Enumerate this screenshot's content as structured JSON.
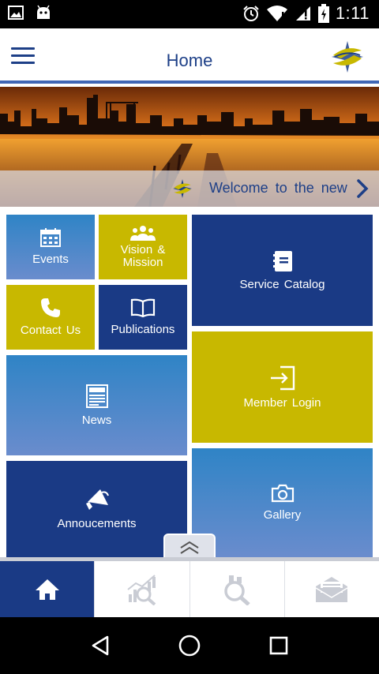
{
  "status_bar": {
    "time": "1:11",
    "left_icons": [
      "image-icon",
      "android-icon"
    ],
    "right_icons": [
      "alarm-icon",
      "wifi-icon",
      "signal-icon",
      "battery-icon"
    ]
  },
  "header": {
    "title": "Home",
    "menu_icon": "hamburger-menu-icon",
    "logo_icon": "star-logo-icon"
  },
  "banner": {
    "welcome_text": "Welcome to the new",
    "next_icon": "chevron-right-icon"
  },
  "tiles": {
    "events": {
      "label": "Events",
      "icon": "calendar-icon"
    },
    "vision": {
      "label": "Vision & Mission",
      "icon": "group-icon"
    },
    "service_catalog": {
      "label": "Service Catalog",
      "icon": "catalog-icon"
    },
    "contact": {
      "label": "Contact Us",
      "icon": "phone-icon"
    },
    "publications": {
      "label": "Publications",
      "icon": "book-icon"
    },
    "news": {
      "label": "News",
      "icon": "newspaper-icon"
    },
    "member_login": {
      "label": "Member Login",
      "icon": "login-icon"
    },
    "announcements": {
      "label": "Annoucements",
      "icon": "megaphone-icon"
    },
    "gallery": {
      "label": "Gallery",
      "icon": "camera-icon"
    }
  },
  "bottom_tabs": [
    {
      "name": "home",
      "icon": "home-icon",
      "active": true
    },
    {
      "name": "analytics-search",
      "icon": "chart-search-icon",
      "active": false
    },
    {
      "name": "search",
      "icon": "search-icon",
      "active": false
    },
    {
      "name": "mail",
      "icon": "mail-icon",
      "active": false
    }
  ],
  "colors": {
    "navy": "#1a3a85",
    "olive": "#c8b800",
    "blue": "#2f84c6",
    "title": "#1d3f87"
  }
}
